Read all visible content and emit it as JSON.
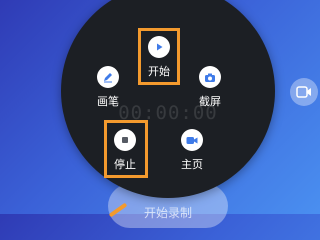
{
  "background": {
    "title": "",
    "button_label": "开始录制"
  },
  "menu": {
    "timer": "00:00:00",
    "items": [
      {
        "id": "start",
        "label": "开始",
        "icon": "play-icon"
      },
      {
        "id": "draw",
        "label": "画笔",
        "icon": "pen-icon"
      },
      {
        "id": "screenshot",
        "label": "截屏",
        "icon": "camera-icon"
      },
      {
        "id": "stop",
        "label": "停止",
        "icon": "stop-icon"
      },
      {
        "id": "home",
        "label": "主页",
        "icon": "video-camera-icon"
      }
    ]
  },
  "side_button": {
    "icon": "video-record-icon"
  },
  "colors": {
    "menu_bg": "#1c1f24",
    "accent_blue": "#3f7be8",
    "highlight_orange": "#f39a2e"
  }
}
